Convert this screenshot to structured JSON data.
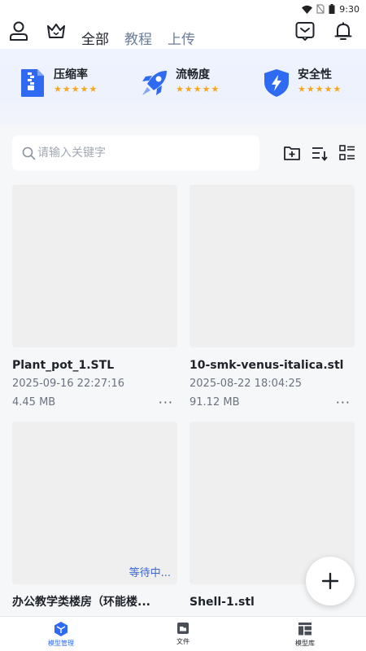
{
  "status_bar": {
    "time": "9:30"
  },
  "header": {
    "tabs": [
      {
        "label": "全部",
        "active": true
      },
      {
        "label": "教程",
        "active": false
      },
      {
        "label": "上传",
        "active": false
      }
    ]
  },
  "features": [
    {
      "label": "压缩率",
      "stars": "★★★★★",
      "icon": "zip-file-icon"
    },
    {
      "label": "流畅度",
      "stars": "★★★★★",
      "icon": "rocket-icon"
    },
    {
      "label": "安全性",
      "stars": "★★★★★",
      "icon": "shield-bolt-icon"
    }
  ],
  "search": {
    "placeholder": "请输入关键字"
  },
  "files": [
    {
      "name": "Plant_pot_1.STL",
      "date": "2025-09-16 22:27:16",
      "size": "4.45 MB",
      "more": "···"
    },
    {
      "name": "10-smk-venus-italica.stl",
      "date": "2025-08-22 18:04:25",
      "size": "91.12 MB",
      "more": "···"
    },
    {
      "name": "办公教学类楼房（环能楼...",
      "status": "等待中..."
    },
    {
      "name": "Shell-1.stl"
    }
  ],
  "bottom_nav": [
    {
      "label": "模型管理",
      "active": true
    },
    {
      "label": "文件",
      "active": false
    },
    {
      "label": "模型库",
      "active": false
    }
  ],
  "colors": {
    "accent": "#2f6bf2",
    "inactive_tab": "#6b7c99",
    "star": "#f5a623",
    "waiting": "#3a66d8"
  }
}
